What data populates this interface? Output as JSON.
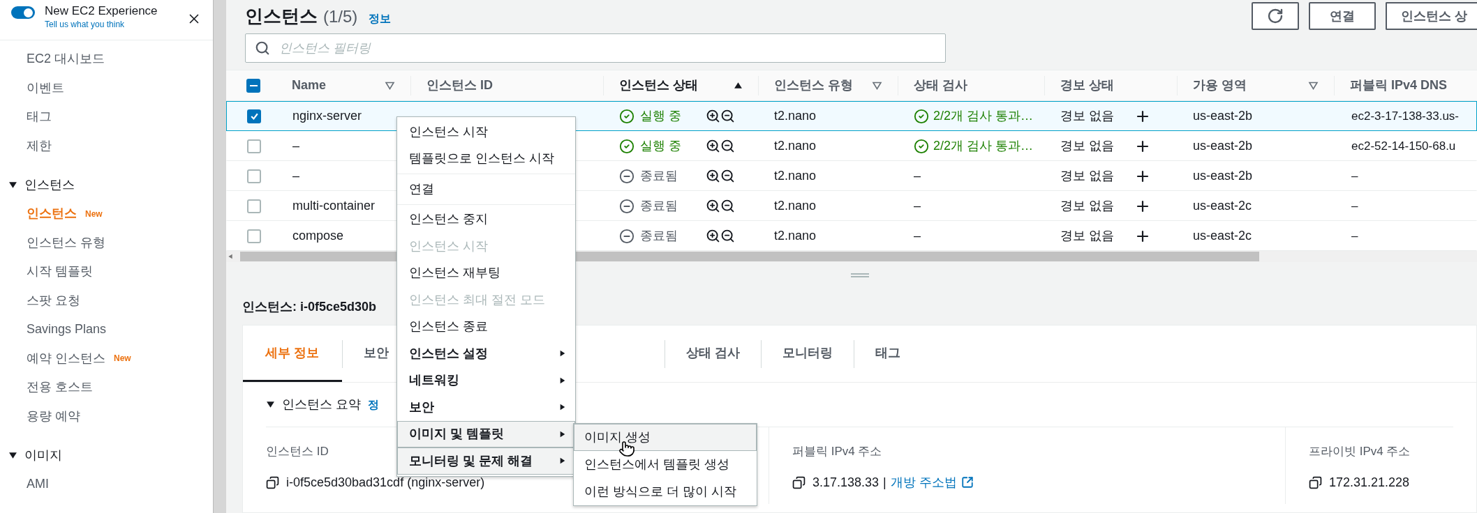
{
  "experience_banner": {
    "title": "New EC2 Experience",
    "link": "Tell us what you think",
    "on": true
  },
  "sidebar": {
    "groups": [
      {
        "items": [
          {
            "label": "EC2 대시보드",
            "selected": false
          },
          {
            "label": "이벤트",
            "selected": false
          },
          {
            "label": "태그",
            "selected": false
          },
          {
            "label": "제한",
            "selected": false
          }
        ]
      },
      {
        "title": "인스턴스",
        "expanded": true,
        "items": [
          {
            "label": "인스턴스",
            "badge": "New",
            "selected": true
          },
          {
            "label": "인스턴스 유형",
            "selected": false
          },
          {
            "label": "시작 템플릿",
            "selected": false
          },
          {
            "label": "스팟 요청",
            "selected": false
          },
          {
            "label": "Savings Plans",
            "selected": false
          },
          {
            "label": "예약 인스턴스",
            "badge": "New",
            "selected": false
          },
          {
            "label": "전용 호스트",
            "selected": false
          },
          {
            "label": "용량 예약",
            "selected": false
          }
        ]
      },
      {
        "title": "이미지",
        "expanded": true,
        "items": [
          {
            "label": "AMI",
            "selected": false
          }
        ]
      }
    ]
  },
  "header": {
    "title": "인스턴스",
    "count": "(1/5)",
    "info_link": "정보",
    "buttons": [
      {
        "kind": "refresh"
      },
      {
        "kind": "text",
        "label": "연결"
      },
      {
        "kind": "text",
        "label": "인스턴스 상"
      }
    ]
  },
  "search": {
    "placeholder": "인스턴스 필터링"
  },
  "table": {
    "all_checkbox": {
      "indeterminate": true
    },
    "columns": [
      {
        "label": "Name",
        "kind": "filter"
      },
      {
        "label": "인스턴스 ID",
        "kind": "plain"
      },
      {
        "label": "인스턴스 상태",
        "kind": "sorted"
      },
      {
        "label": "인스턴스 유형",
        "kind": "filter"
      },
      {
        "label": "상태 검사",
        "kind": "plain"
      },
      {
        "label": "경보 상태",
        "kind": "plain"
      },
      {
        "label": "가용 영역",
        "kind": "filter"
      },
      {
        "label": "퍼블릭 IPv4 DNS",
        "kind": "plain"
      }
    ],
    "rows": [
      {
        "selected": true,
        "name": "nginx-server",
        "state": {
          "kind": "running",
          "label": "실행 중"
        },
        "type": "t2.nano",
        "check": {
          "kind": "passed",
          "label": "2/2개 검사 통과…"
        },
        "alarm": "경보 없음",
        "zone": "us-east-2b",
        "dns": "ec2-3-17-138-33.us-"
      },
      {
        "selected": false,
        "name": "–",
        "state": {
          "kind": "running",
          "label": "실행 중"
        },
        "type": "t2.nano",
        "check": {
          "kind": "passed",
          "label": "2/2개 검사 통과…"
        },
        "alarm": "경보 없음",
        "zone": "us-east-2b",
        "dns": "ec2-52-14-150-68.u"
      },
      {
        "selected": false,
        "name": "–",
        "state": {
          "kind": "terminated",
          "label": "종료됨"
        },
        "type": "t2.nano",
        "check": {
          "kind": "none",
          "label": "–"
        },
        "alarm": "경보 없음",
        "zone": "us-east-2b",
        "dns": "–"
      },
      {
        "selected": false,
        "name": "multi-container",
        "state": {
          "kind": "terminated",
          "label": "종료됨"
        },
        "type": "t2.nano",
        "check": {
          "kind": "none",
          "label": "–"
        },
        "alarm": "경보 없음",
        "zone": "us-east-2c",
        "dns": "–"
      },
      {
        "selected": false,
        "name": "compose",
        "state": {
          "kind": "terminated",
          "label": "종료됨"
        },
        "type": "t2.nano",
        "check": {
          "kind": "none",
          "label": "–"
        },
        "alarm": "경보 없음",
        "zone": "us-east-2c",
        "dns": "–"
      }
    ]
  },
  "detail": {
    "title": "인스턴스: i-0f5ce5d30b",
    "tabs": [
      {
        "label": "세부 정보",
        "selected": true
      },
      {
        "label": "보안",
        "selected": false
      },
      {
        "label": "상태 검사",
        "selected": false
      },
      {
        "label": "모니터링",
        "selected": false
      },
      {
        "label": "태그",
        "selected": false
      }
    ],
    "section": {
      "title": "인스턴스 요약",
      "expanded": true,
      "info_link": "정"
    },
    "fields": [
      {
        "label": "인스턴스 ID",
        "value": "i-0f5ce5d30bad31cdf (nginx-server)"
      },
      {
        "label": "퍼블릭 IPv4 주소",
        "value": "3.17.138.33",
        "separator": "|",
        "link": "개방 주소법"
      },
      {
        "label": "프라이빗 IPv4 주소",
        "value": "172.31.21.228"
      }
    ]
  },
  "context_menu": {
    "items": [
      {
        "kind": "action",
        "label": "인스턴스 시작",
        "disabled": false,
        "highlighted": false
      },
      {
        "kind": "action",
        "label": "템플릿으로 인스턴스 시작",
        "disabled": false,
        "highlighted": false
      },
      {
        "kind": "separator"
      },
      {
        "kind": "action",
        "label": "연결",
        "disabled": false,
        "highlighted": false
      },
      {
        "kind": "separator"
      },
      {
        "kind": "action",
        "label": "인스턴스 중지",
        "disabled": false,
        "highlighted": false
      },
      {
        "kind": "action",
        "label": "인스턴스 시작",
        "disabled": true,
        "highlighted": false
      },
      {
        "kind": "action",
        "label": "인스턴스 재부팅",
        "disabled": false,
        "highlighted": false
      },
      {
        "kind": "action",
        "label": "인스턴스 최대 절전 모드",
        "disabled": true,
        "highlighted": false
      },
      {
        "kind": "action",
        "label": "인스턴스 종료",
        "disabled": false,
        "highlighted": false
      },
      {
        "kind": "submenu",
        "label": "인스턴스 설정",
        "disabled": false,
        "highlighted": false
      },
      {
        "kind": "submenu",
        "label": "네트워킹",
        "disabled": false,
        "highlighted": false
      },
      {
        "kind": "submenu",
        "label": "보안",
        "disabled": false,
        "highlighted": false
      },
      {
        "kind": "submenu",
        "label": "이미지 및 템플릿",
        "disabled": false,
        "highlighted": true
      },
      {
        "kind": "submenu",
        "label": "모니터링 및 문제 해결",
        "disabled": false,
        "highlighted": true
      }
    ],
    "submenu": [
      {
        "label": "이미지 생성",
        "highlighted": true
      },
      {
        "label": "인스턴스에서 템플릿 생성",
        "highlighted": false
      },
      {
        "label": "이런 방식으로 더 많이 시작",
        "highlighted": false
      }
    ]
  }
}
